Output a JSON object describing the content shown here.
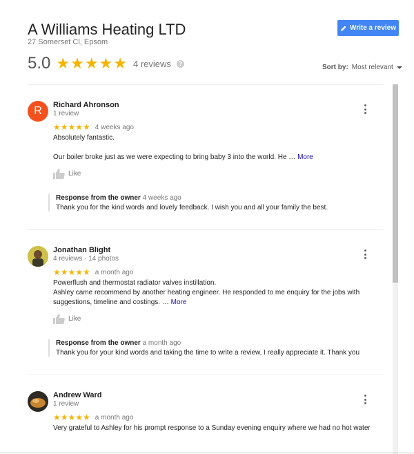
{
  "business": {
    "name": "A Williams Heating LTD",
    "address": "27 Somerset Cl, Epsom",
    "rating": "5.0",
    "stars": "★★★★★",
    "review_count": "4 reviews",
    "help_glyph": "?"
  },
  "write_review": {
    "label": "Write a review"
  },
  "sort": {
    "label": "Sort by:",
    "value": "Most relevant"
  },
  "colors": {
    "accent": "#4285f4",
    "star": "#f4b400",
    "link": "#1a0dab",
    "avatar_r": "#f4511e"
  },
  "reviews": [
    {
      "initial": "R",
      "name": "Richard Ahronson",
      "meta": "1 review",
      "stars": "★★★★★",
      "ago": "4 weeks ago",
      "title": "Absolutely fantastic.",
      "body": "Our boiler broke just as we were expecting to bring baby 3 into the world. He …",
      "more": "More",
      "like": "Like",
      "owner_label": "Response from the owner",
      "owner_ago": "4 weeks ago",
      "owner_text": "Thank you for the kind words and lovely feedback. I wish you and all your family the best."
    },
    {
      "name": "Jonathan Blight",
      "meta": "4 reviews · 14 photos",
      "stars": "★★★★★",
      "ago": "a month ago",
      "title": "Powerflush and thermostat radiator valves instillation.",
      "body1": "Ashley came recommend by another heating engineer. He responded to me enquiry for the jobs with",
      "body2": "suggestions, timeline and costings. …",
      "more": "More",
      "like": "Like",
      "owner_label": "Response from the owner",
      "owner_ago": "a month ago",
      "owner_text": "Thank you for your kind words and taking the time to write a review. I really appreciate it. Thank you"
    },
    {
      "name": "Andrew Ward",
      "meta": "1 review",
      "stars": "★★★★★",
      "ago": "a month ago",
      "body": "Very grateful to Ashley for his prompt response to a Sunday evening enquiry where we had no hot water"
    }
  ]
}
